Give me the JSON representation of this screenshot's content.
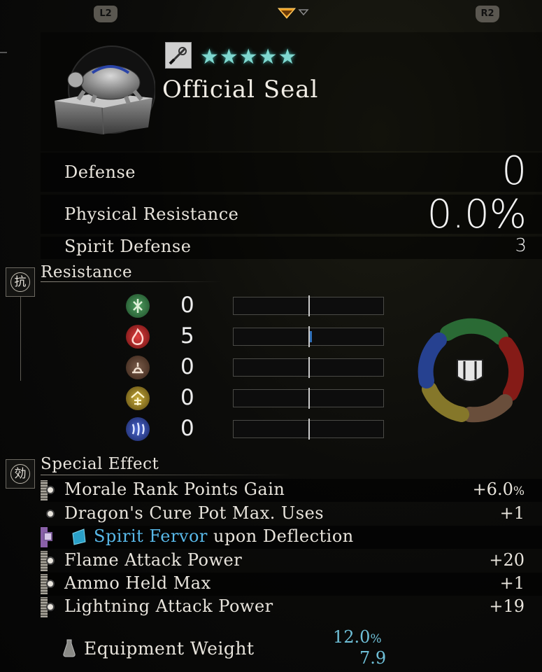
{
  "nav": {
    "left_button": "L2",
    "right_button": "R2"
  },
  "item": {
    "name": "Official Seal",
    "rarity_stars": 5,
    "stars_text": "★★★★★",
    "type_icon": "accessory-scroll-icon",
    "image_icon": "turtle-seal-icon"
  },
  "stats": [
    {
      "label": "Defense",
      "value": "0"
    },
    {
      "label": "Physical Resistance",
      "value": "0.0",
      "unit": "%"
    },
    {
      "label": "Spirit Defense",
      "value": "3"
    }
  ],
  "resistance": {
    "title": "Resistance",
    "title_icon_char": "抗",
    "rows": [
      {
        "element": "wood",
        "icon": "wood-rune-icon",
        "value": "0",
        "level": 0,
        "color": "#3e8a4e"
      },
      {
        "element": "fire",
        "icon": "fire-icon",
        "value": "5",
        "level": 0.03,
        "color": "#c22a22"
      },
      {
        "element": "earth",
        "icon": "earth-icon",
        "value": "0",
        "level": 0,
        "color": "#6e5040"
      },
      {
        "element": "metal",
        "icon": "metal-icon",
        "value": "0",
        "level": 0,
        "color": "#b59a2e"
      },
      {
        "element": "water",
        "icon": "water-icon",
        "value": "0",
        "level": 0,
        "color": "#3050b8"
      }
    ]
  },
  "special_effect": {
    "title": "Special Effect",
    "title_icon_char": "効",
    "rows": [
      {
        "label": "Morale Rank Points Gain",
        "value": "+6.0",
        "unit": "%"
      },
      {
        "label": "Dragon's Cure Pot Max. Uses",
        "value": "+1"
      },
      {
        "label_highlight": "Spirit Fervor",
        "label_rest": " upon Deflection",
        "highlight_color": "#58b8e8"
      },
      {
        "label": "Flame Attack Power",
        "value": "+20"
      },
      {
        "label": "Ammo Held Max",
        "value": "+1"
      },
      {
        "label": "Lightning Attack Power",
        "value": "+19"
      }
    ]
  },
  "weight": {
    "label": "Equipment Weight",
    "percent": "12.0",
    "percent_unit": "%",
    "value": "7.9",
    "color": "#6fc0d8"
  }
}
